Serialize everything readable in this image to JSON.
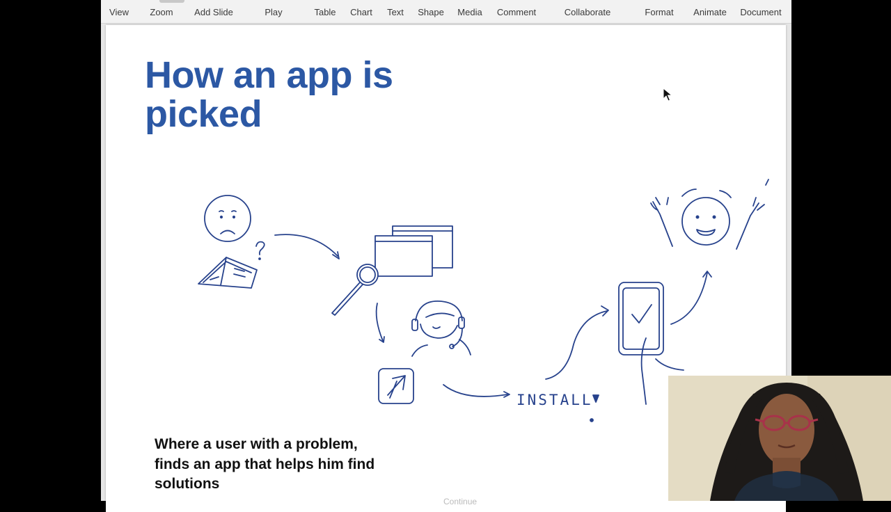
{
  "toolbar": {
    "items": [
      {
        "label": "View",
        "name": "view"
      },
      {
        "label": "Zoom",
        "name": "zoom"
      },
      {
        "label": "Add Slide",
        "name": "add-slide"
      },
      {
        "label": "Play",
        "name": "play"
      },
      {
        "label": "Table",
        "name": "table"
      },
      {
        "label": "Chart",
        "name": "chart"
      },
      {
        "label": "Text",
        "name": "text"
      },
      {
        "label": "Shape",
        "name": "shape"
      },
      {
        "label": "Media",
        "name": "media"
      },
      {
        "label": "Comment",
        "name": "comment"
      },
      {
        "label": "Collaborate",
        "name": "collaborate"
      },
      {
        "label": "Format",
        "name": "format"
      },
      {
        "label": "Animate",
        "name": "animate"
      },
      {
        "label": "Document",
        "name": "document"
      }
    ]
  },
  "slide": {
    "title": "How an app is picked",
    "caption": "Where a user with a problem, finds an app that helps him find solutions",
    "sketch_label": "INSTALL",
    "ghost_text": "Continue"
  },
  "colors": {
    "title_blue": "#2c58a4",
    "sketch_ink": "#27428c",
    "toolbar_bg": "#f2f2f2",
    "slide_bg": "#ffffff"
  },
  "icons": [
    "mouse-pointer-icon"
  ]
}
